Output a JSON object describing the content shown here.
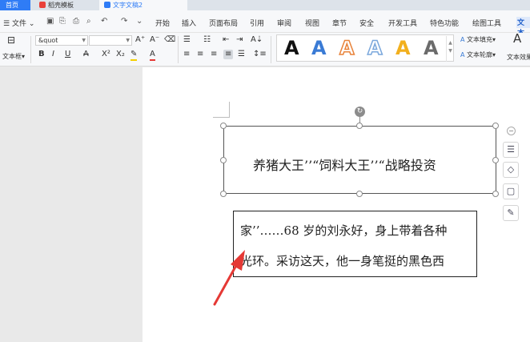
{
  "tabs": {
    "home": "首页",
    "daoke": "稻壳模板",
    "doc": "文字文稿2"
  },
  "menu": {
    "file": "文件",
    "items": [
      "开始",
      "插入",
      "页面布局",
      "引用",
      "审阅",
      "视图",
      "章节",
      "安全",
      "开发工具",
      "特色功能",
      "绘图工具",
      "文本"
    ]
  },
  "ribbon": {
    "textbox_label": "文本框",
    "font_name": "&quot",
    "font_size": "",
    "text_fill": "文本填充",
    "text_outline": "文本轮廓",
    "text_effect": "文本效果",
    "style_glyph": "A",
    "colors": {
      "style1": "#111111",
      "style2": "#3a7bd5",
      "style3": "#e8833a",
      "style4": "#7aa7dc",
      "style5": "#f2b01e",
      "style6": "#6b6b6b"
    }
  },
  "document": {
    "textbox1_text": "养猪大王’’“饲料大王’’“战略投资",
    "textbox2_line1": "家’’……68 岁的刘永好，身上带着各种",
    "textbox2_line2": "光环。采访这天，他一身笔挺的黑色西"
  }
}
